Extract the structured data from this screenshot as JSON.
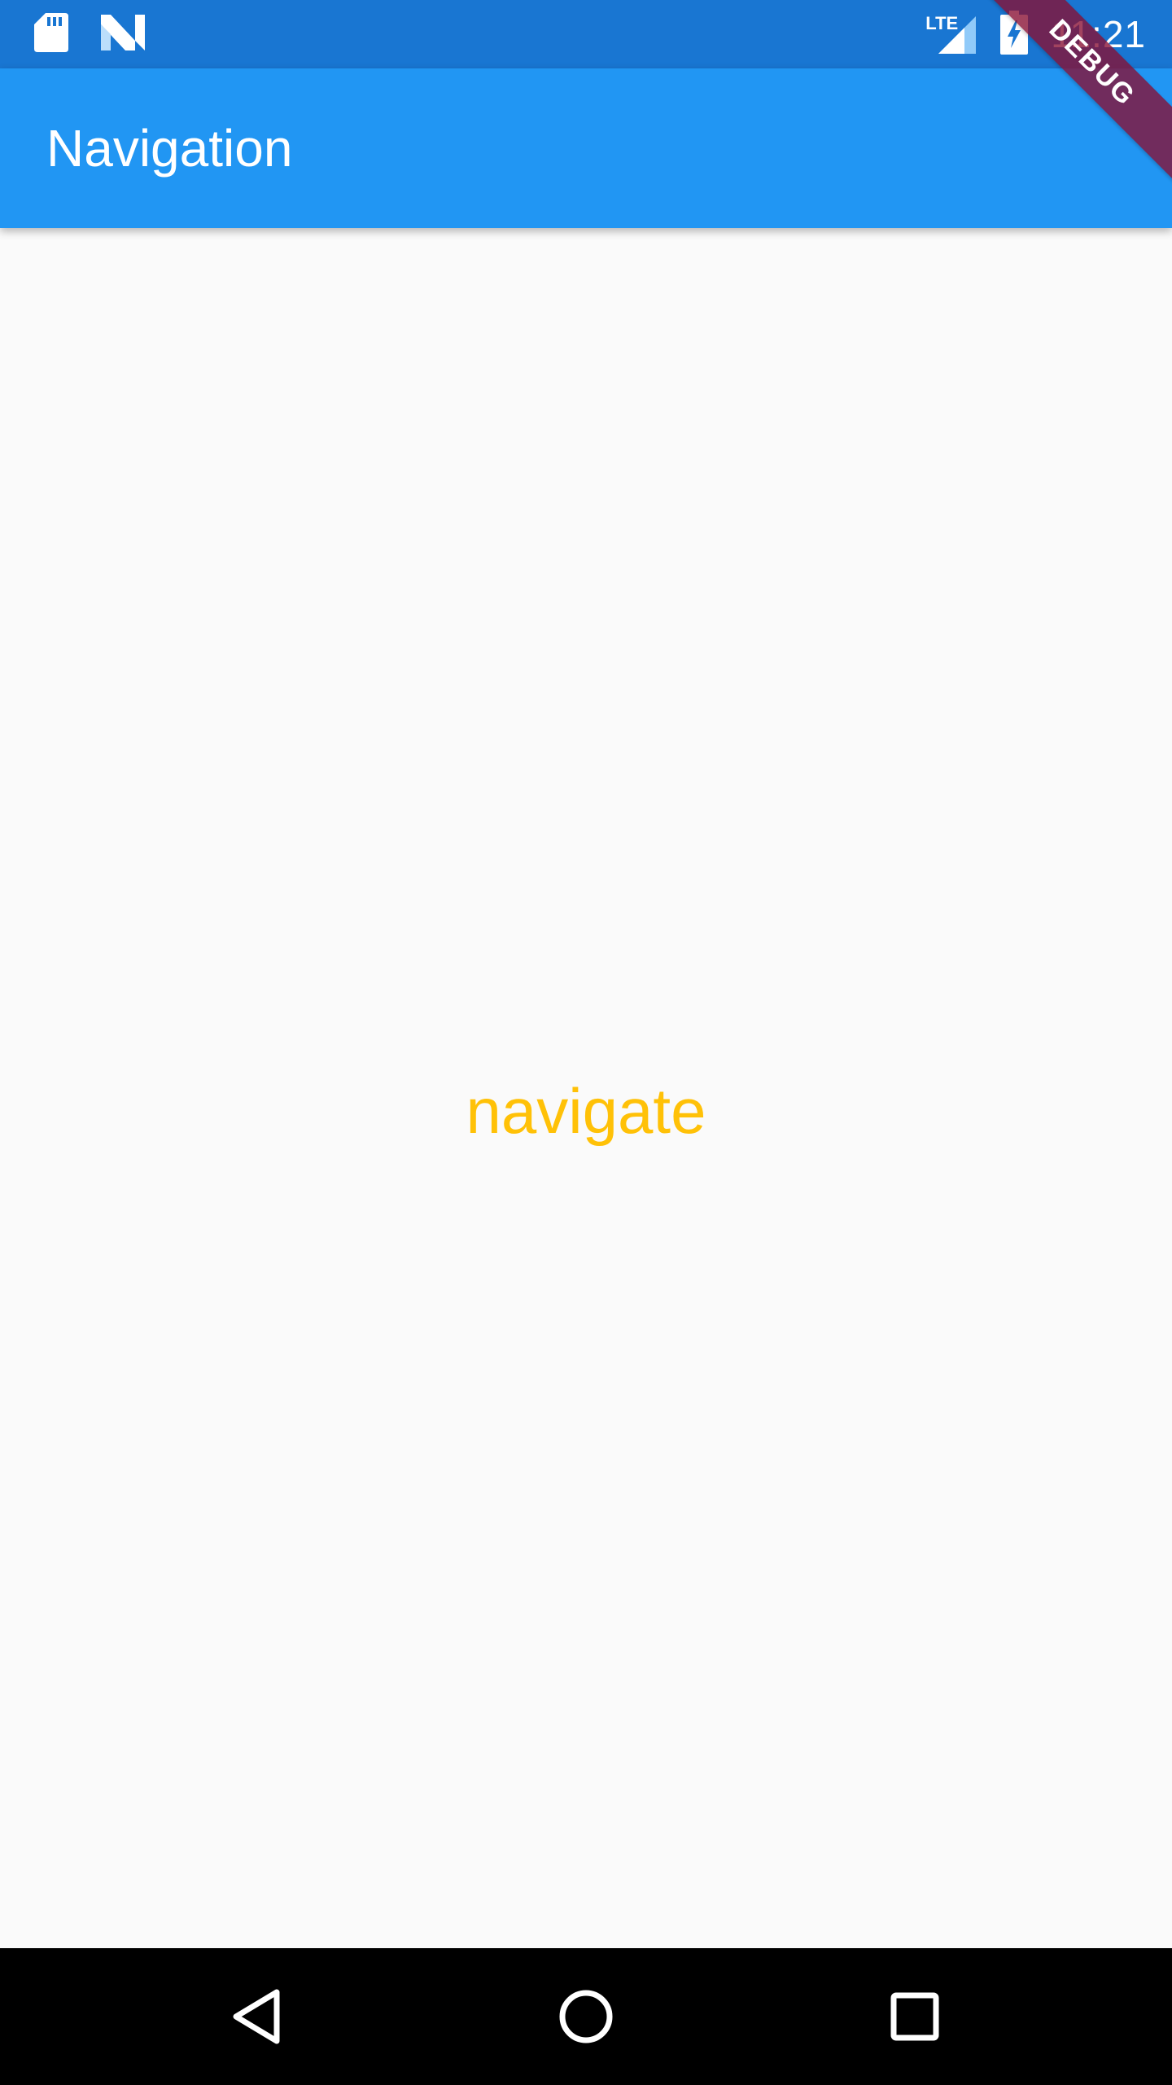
{
  "status_bar": {
    "time": "11:21",
    "network_label": "LTE",
    "background_color": "#1976d2",
    "icons": [
      "sd-card-icon",
      "n-logo-icon",
      "signal-icon",
      "battery-charging-icon"
    ]
  },
  "app_bar": {
    "title": "Navigation",
    "background_color": "#2196f3"
  },
  "debug_banner": {
    "label": "DEBUG"
  },
  "main": {
    "navigate_label": "navigate",
    "navigate_color": "#ffc107"
  },
  "nav_bar": {
    "icons": [
      "back-icon",
      "home-icon",
      "recents-icon"
    ]
  }
}
